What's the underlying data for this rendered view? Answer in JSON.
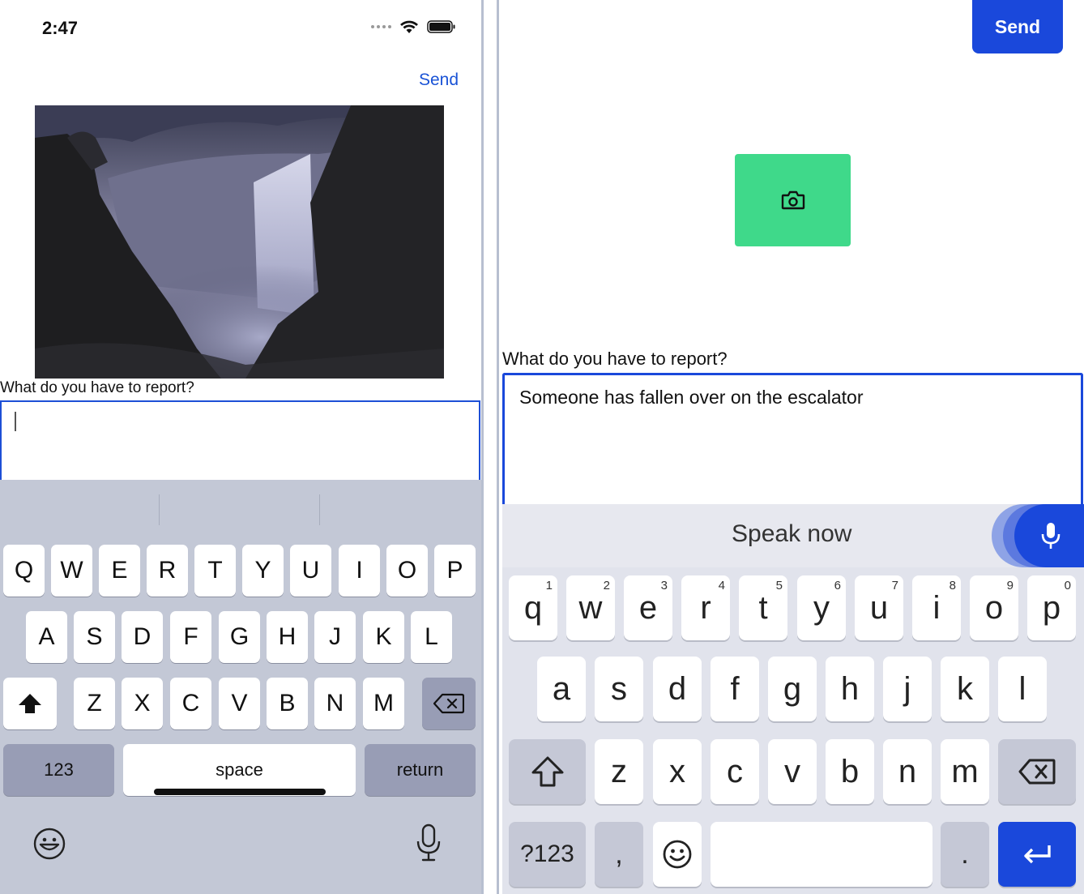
{
  "ios": {
    "status": {
      "time": "2:47"
    },
    "header": {
      "send_label": "Send"
    },
    "form": {
      "prompt": "What do you have to report?",
      "input_value": ""
    },
    "keyboard": {
      "row1": [
        "Q",
        "W",
        "E",
        "R",
        "T",
        "Y",
        "U",
        "I",
        "O",
        "P"
      ],
      "row2": [
        "A",
        "S",
        "D",
        "F",
        "G",
        "H",
        "J",
        "K",
        "L"
      ],
      "row3": [
        "Z",
        "X",
        "C",
        "V",
        "B",
        "N",
        "M"
      ],
      "numbers_label": "123",
      "space_label": "space",
      "return_label": "return"
    }
  },
  "android": {
    "header": {
      "send_label": "Send"
    },
    "camera_button": {
      "icon": "camera-icon",
      "color": "#3fd98a"
    },
    "form": {
      "prompt": "What do you have to report?",
      "input_value": "Someone has fallen over on the escalator"
    },
    "voice": {
      "label": "Speak now"
    },
    "keyboard": {
      "row1": [
        "q",
        "w",
        "e",
        "r",
        "t",
        "y",
        "u",
        "i",
        "o",
        "p"
      ],
      "row1_hints": [
        "1",
        "2",
        "3",
        "4",
        "5",
        "6",
        "7",
        "8",
        "9",
        "0"
      ],
      "row2": [
        "a",
        "s",
        "d",
        "f",
        "g",
        "h",
        "j",
        "k",
        "l"
      ],
      "row3": [
        "z",
        "x",
        "c",
        "v",
        "b",
        "n",
        "m"
      ],
      "symbols_label": "?123",
      "comma_label": ",",
      "period_label": "."
    },
    "accent_color": "#1a48db"
  }
}
